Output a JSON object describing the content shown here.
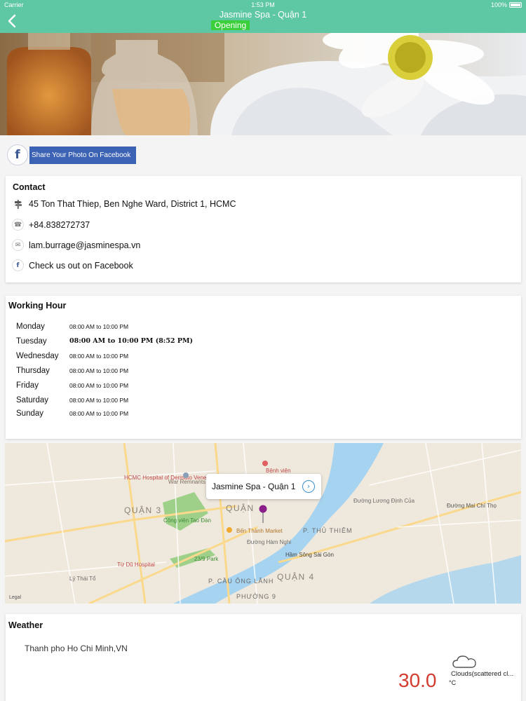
{
  "status_bar": {
    "carrier": "Carrier",
    "time": "1:53 PM",
    "battery": "100%"
  },
  "nav": {
    "title": "Jasmine Spa - Quận 1",
    "status": "Opening"
  },
  "share": {
    "label": "Share Your Photo On Facebook"
  },
  "contact": {
    "title": "Contact",
    "address": "45 Ton That Thiep, Ben Nghe Ward, District 1, HCMC",
    "phone": "+84.838272737",
    "email": "lam.burrage@jasminespa.vn",
    "facebook": "Check us out on Facebook"
  },
  "hours": {
    "title": "Working Hour",
    "rows": [
      {
        "day": "Monday",
        "time": "08:00 AM to 10:00 PM"
      },
      {
        "day": "Tuesday",
        "time": "08:00 AM to 10:00 PM (8:52 PM)"
      },
      {
        "day": "Wednesday",
        "time": "08:00 AM to 10:00 PM"
      },
      {
        "day": "Thursday",
        "time": "08:00 AM to 10:00 PM"
      },
      {
        "day": "Friday",
        "time": "08:00 AM to 10:00 PM"
      },
      {
        "day": "Saturday",
        "time": "08:00 AM to 10:00 PM"
      },
      {
        "day": "Sunday",
        "time": "08:00 AM to 10:00 PM"
      }
    ]
  },
  "map": {
    "callout": "Jasmine Spa - Quận 1",
    "legal": "Legal",
    "labels": [
      "QUẬN 3",
      "QUẬN",
      "QUẬN 4",
      "P. THỦ THIÊM",
      "Công viên Tao Đàn",
      "23/9 Park",
      "Bến Thành Market",
      "Bệnh viện",
      "War Remnants Museum",
      "HCMC Hospital of Dermato Venereology",
      "Từ Dũ Hospital",
      "Hầm Sông Sài Gòn",
      "Đường Mai Chí Thọ",
      "Đường Hàm Nghi",
      "Lý Thái Tổ",
      "P. CẦU ÔNG LÃNH",
      "PHƯỜNG 9",
      "Đường Lương Định Của"
    ]
  },
  "weather": {
    "title": "Weather",
    "city": "Thanh pho Ho Chi Minh,VN",
    "condition": "Clouds(scattered cl...",
    "temperature": "30.0",
    "unit": "°C"
  },
  "colors": {
    "accent": "#5ec7a4",
    "opening": "#3ccf3c",
    "facebook": "#3b62b3",
    "temperature": "#d23b2f"
  }
}
